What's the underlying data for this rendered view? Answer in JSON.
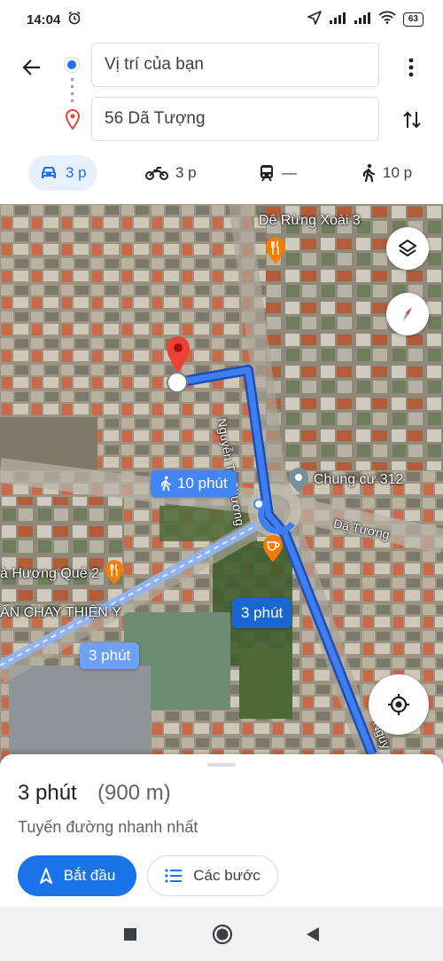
{
  "status_bar": {
    "time": "14:04",
    "battery": "63",
    "icons": [
      "alarm-icon",
      "location-arrow-icon",
      "signal-icon",
      "signal-icon",
      "wifi-icon",
      "battery-icon"
    ]
  },
  "directions": {
    "origin_value": "Vị trí của bạn",
    "destination_value": "56 Dã Tượng"
  },
  "modes": [
    {
      "name": "car",
      "label": "3 p",
      "active": true
    },
    {
      "name": "motorbike",
      "label": "3 p",
      "active": false
    },
    {
      "name": "transit",
      "label": "—",
      "active": false
    },
    {
      "name": "walk",
      "label": "10 p",
      "active": false
    }
  ],
  "map": {
    "labels": {
      "poi_goat": "Dê Rừng Xoài 3",
      "poi_apartment": "Chung cư 312",
      "poi_huong_que": "à Hương Quê 2",
      "poi_chay": "ẤN CHAY THIỆN Ý",
      "street_nguyen_tri_phuong": "Nguyễn Tri Phương",
      "street_da_tuong": "Dã Tượng",
      "street_nguyen_bottom": "Nguy"
    },
    "walk_bubble": "10 phút",
    "route_bubble_main": "3 phút",
    "route_bubble_alt": "3 phút",
    "colors": {
      "route_primary": "#3a78e8",
      "route_alt": "#8fb4f5",
      "pin": "#ea4335"
    }
  },
  "sheet": {
    "time": "3 phút",
    "distance": "(900 m)",
    "description": "Tuyến đường nhanh nhất",
    "start_label": "Bắt đầu",
    "steps_label": "Các bước"
  }
}
